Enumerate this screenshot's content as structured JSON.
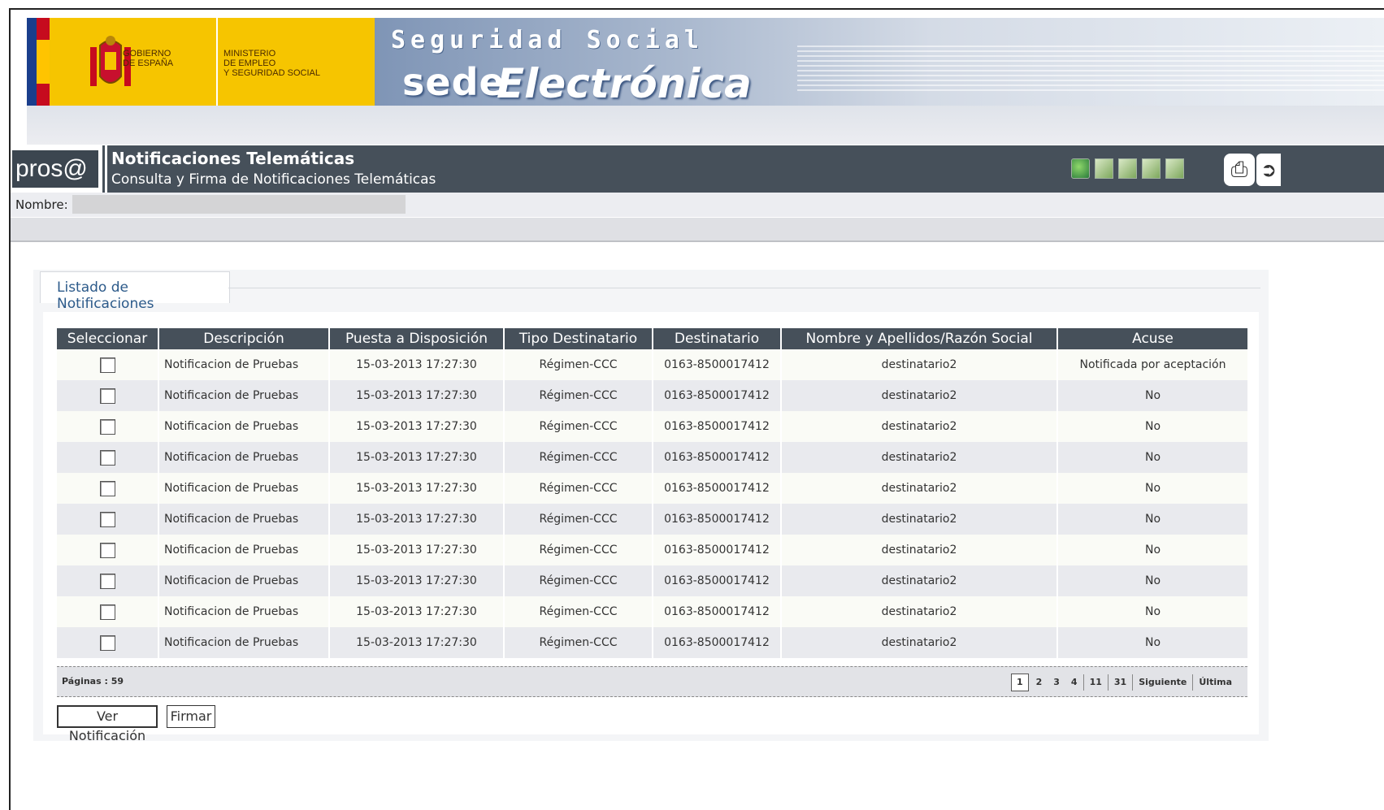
{
  "header": {
    "gov_line1": "GOBIERNO",
    "gov_line2": "DE ESPAÑA",
    "ministry_line1": "MINISTERIO",
    "ministry_line2": "DE EMPLEO",
    "ministry_line3": "Y SEGURIDAD SOCIAL",
    "seguridad_social": "Seguridad Social",
    "sede": "sede",
    "electronica": "Electrónica"
  },
  "appbar": {
    "logo_text": "pros@",
    "title": "Notificaciones Telemáticas",
    "subtitle": "Consulta y Firma de Notificaciones Telemáticas"
  },
  "user": {
    "name_label": "Nombre:"
  },
  "panel": {
    "tab_label": "Listado de Notificaciones"
  },
  "table": {
    "columns": [
      "Seleccionar",
      "Descripción",
      "Puesta a Disposición",
      "Tipo Destinatario",
      "Destinatario",
      "Nombre y Apellidos/Razón Social",
      "Acuse"
    ],
    "rows": [
      {
        "descripcion": "Notificacion de Pruebas",
        "puesta": "15-03-2013 17:27:30",
        "tipo": "Régimen-CCC",
        "destinatario": "0163-8500017412",
        "nombre": "destinatario2",
        "acuse": "Notificada por aceptación"
      },
      {
        "descripcion": "Notificacion de Pruebas",
        "puesta": "15-03-2013 17:27:30",
        "tipo": "Régimen-CCC",
        "destinatario": "0163-8500017412",
        "nombre": "destinatario2",
        "acuse": "No"
      },
      {
        "descripcion": "Notificacion de Pruebas",
        "puesta": "15-03-2013 17:27:30",
        "tipo": "Régimen-CCC",
        "destinatario": "0163-8500017412",
        "nombre": "destinatario2",
        "acuse": "No"
      },
      {
        "descripcion": "Notificacion de Pruebas",
        "puesta": "15-03-2013 17:27:30",
        "tipo": "Régimen-CCC",
        "destinatario": "0163-8500017412",
        "nombre": "destinatario2",
        "acuse": "No"
      },
      {
        "descripcion": "Notificacion de Pruebas",
        "puesta": "15-03-2013 17:27:30",
        "tipo": "Régimen-CCC",
        "destinatario": "0163-8500017412",
        "nombre": "destinatario2",
        "acuse": "No"
      },
      {
        "descripcion": "Notificacion de Pruebas",
        "puesta": "15-03-2013 17:27:30",
        "tipo": "Régimen-CCC",
        "destinatario": "0163-8500017412",
        "nombre": "destinatario2",
        "acuse": "No"
      },
      {
        "descripcion": "Notificacion de Pruebas",
        "puesta": "15-03-2013 17:27:30",
        "tipo": "Régimen-CCC",
        "destinatario": "0163-8500017412",
        "nombre": "destinatario2",
        "acuse": "No"
      },
      {
        "descripcion": "Notificacion de Pruebas",
        "puesta": "15-03-2013 17:27:30",
        "tipo": "Régimen-CCC",
        "destinatario": "0163-8500017412",
        "nombre": "destinatario2",
        "acuse": "No"
      },
      {
        "descripcion": "Notificacion de Pruebas",
        "puesta": "15-03-2013 17:27:30",
        "tipo": "Régimen-CCC",
        "destinatario": "0163-8500017412",
        "nombre": "destinatario2",
        "acuse": "No"
      },
      {
        "descripcion": "Notificacion de Pruebas",
        "puesta": "15-03-2013 17:27:30",
        "tipo": "Régimen-CCC",
        "destinatario": "0163-8500017412",
        "nombre": "destinatario2",
        "acuse": "No"
      }
    ]
  },
  "pager": {
    "pages_label": "Páginas : 59",
    "current": "1",
    "links": [
      "2",
      "3",
      "4",
      "11",
      "31",
      "Siguiente",
      "Última"
    ]
  },
  "actions": {
    "ver_label": "Ver Notificación",
    "firmar_label": "Firmar"
  },
  "colors": {
    "appbar_bg": "#46505a",
    "gov_yellow": "#f6c500",
    "link_blue": "#2c5a8a"
  }
}
